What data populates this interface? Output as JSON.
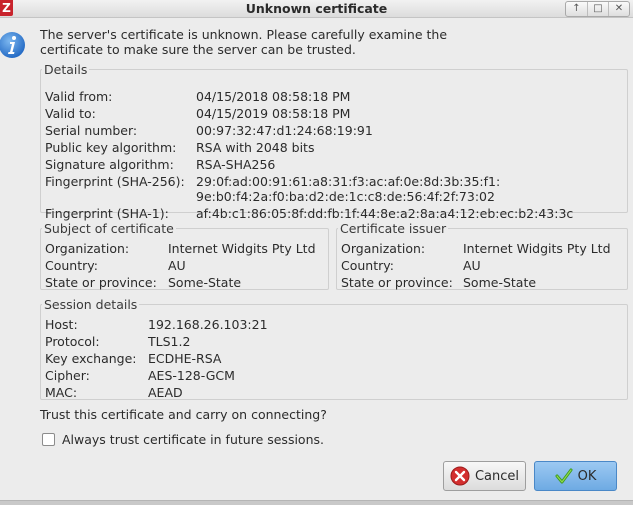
{
  "window": {
    "title": "Unknown certificate",
    "app_icon": "Z"
  },
  "message": "The server's certificate is unknown. Please carefully examine the certificate to make sure the server can be trusted.",
  "details": {
    "legend": "Details",
    "rows": [
      {
        "label": "Valid from:",
        "value": "04/15/2018 08:58:18 PM"
      },
      {
        "label": "Valid to:",
        "value": "04/15/2019 08:58:18 PM"
      },
      {
        "label": "Serial number:",
        "value": "00:97:32:47:d1:24:68:19:91"
      },
      {
        "label": "Public key algorithm:",
        "value": "RSA with 2048 bits"
      },
      {
        "label": "Signature algorithm:",
        "value": "RSA-SHA256"
      },
      {
        "label": "Fingerprint (SHA-256):",
        "value": "29:0f:ad:00:91:61:a8:31:f3:ac:af:0e:8d:3b:35:f1:",
        "value2": "9e:b0:f4:2a:f0:ba:d2:de:1c:c8:de:56:4f:2f:73:02"
      },
      {
        "label": "Fingerprint (SHA-1):",
        "value": "af:4b:c1:86:05:8f:dd:fb:1f:44:8e:a2:8a:a4:12:eb:ec:b2:43:3c"
      }
    ]
  },
  "subject": {
    "legend": "Subject of certificate",
    "rows": [
      {
        "label": "Organization:",
        "value": "Internet Widgits Pty Ltd"
      },
      {
        "label": "Country:",
        "value": "AU"
      },
      {
        "label": "State or province:",
        "value": "Some-State"
      }
    ]
  },
  "issuer": {
    "legend": "Certificate issuer",
    "rows": [
      {
        "label": "Organization:",
        "value": "Internet Widgits Pty Ltd"
      },
      {
        "label": "Country:",
        "value": "AU"
      },
      {
        "label": "State or province:",
        "value": "Some-State"
      }
    ]
  },
  "session": {
    "legend": "Session details",
    "rows": [
      {
        "label": "Host:",
        "value": "192.168.26.103:21"
      },
      {
        "label": "Protocol:",
        "value": "TLS1.2"
      },
      {
        "label": "Key exchange:",
        "value": "ECDHE-RSA"
      },
      {
        "label": "Cipher:",
        "value": "AES-128-GCM"
      },
      {
        "label": "MAC:",
        "value": "AEAD"
      }
    ]
  },
  "question": "Trust this certificate and carry on connecting?",
  "always_trust": {
    "label": "Always trust certificate in future sessions.",
    "checked": false
  },
  "buttons": {
    "cancel": {
      "label": "Cancel",
      "icon": "cancel-icon"
    },
    "ok": {
      "label": "OK",
      "icon": "checkmark-icon"
    }
  },
  "colors": {
    "ok_button": "#7ab4e8",
    "cancel_icon": "#d32f2f",
    "info_icon": "#2f7fd8"
  }
}
